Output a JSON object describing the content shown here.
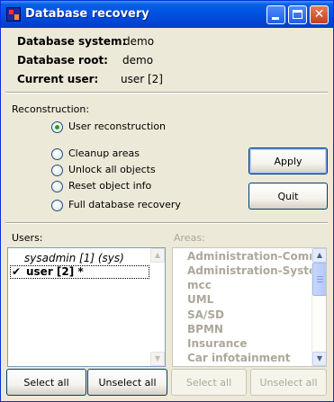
{
  "window": {
    "title": "Database recovery"
  },
  "info": {
    "db_system_label": "Database system:",
    "db_system_value": "demo",
    "db_root_label": "Database root:",
    "db_root_value": "demo",
    "current_user_label": "Current user:",
    "current_user_value": "user [2]"
  },
  "reconstruction": {
    "label": "Reconstruction:",
    "options": [
      {
        "label": "User reconstruction",
        "checked": true
      },
      {
        "label": "Cleanup areas",
        "checked": false
      },
      {
        "label": "Unlock all objects",
        "checked": false
      },
      {
        "label": "Reset object info",
        "checked": false
      },
      {
        "label": "Full database recovery",
        "checked": false
      }
    ]
  },
  "buttons": {
    "apply": "Apply",
    "quit": "Quit",
    "users_select_all": "Select all",
    "users_unselect_all": "Unselect all",
    "areas_select_all": "Select all",
    "areas_unselect_all": "Unselect all"
  },
  "users": {
    "label": "Users:",
    "items": [
      {
        "text": "sysadmin [1]  (sys)",
        "checked": false
      },
      {
        "text": "user [2] *",
        "checked": true
      }
    ]
  },
  "areas": {
    "label": "Areas:",
    "items": [
      "Administration-Comm",
      "Administration-Syster",
      "mcc",
      "UML",
      "SA/SD",
      "BPMN",
      "Insurance",
      "Car infotainment"
    ]
  },
  "icons": {
    "app": "database-recovery-app-icon",
    "minimize": "minimize-icon",
    "maximize": "maximize-icon",
    "close": "close-icon",
    "scroll_up": "scroll-up-arrow-icon",
    "scroll_down": "scroll-down-arrow-icon",
    "check": "checkmark-icon"
  }
}
